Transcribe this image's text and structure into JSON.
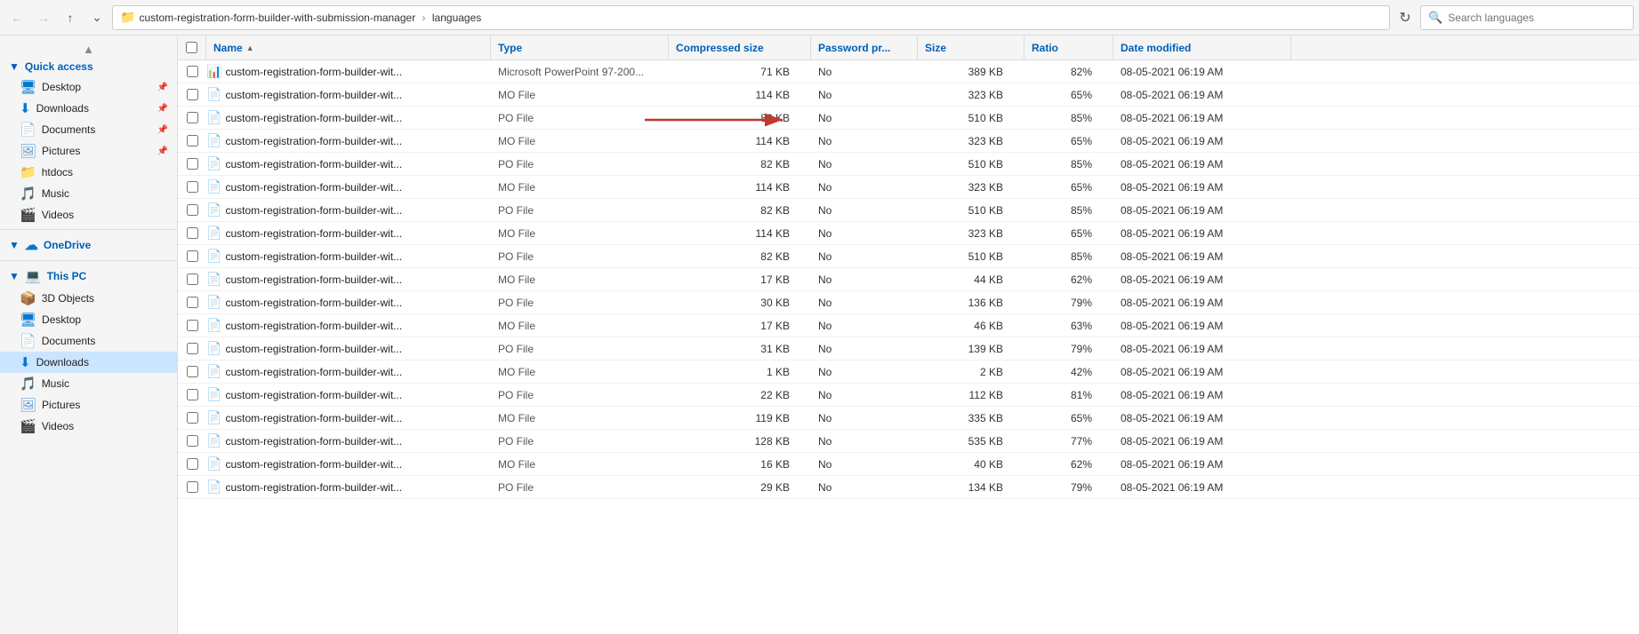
{
  "toolbar": {
    "back_disabled": true,
    "forward_disabled": true,
    "up_label": "Up",
    "address": {
      "icon": "📁",
      "path_part1": "custom-registration-form-builder-with-submission-manager",
      "separator": "›",
      "path_part2": "languages"
    },
    "search_placeholder": "Search languages"
  },
  "sidebar": {
    "quick_access_label": "Quick access",
    "items_quick": [
      {
        "id": "desktop",
        "label": "Desktop",
        "icon": "desktop",
        "pinned": true
      },
      {
        "id": "downloads",
        "label": "Downloads",
        "icon": "downloads",
        "pinned": true,
        "active": true
      },
      {
        "id": "documents",
        "label": "Documents",
        "icon": "docs",
        "pinned": true
      },
      {
        "id": "pictures",
        "label": "Pictures",
        "icon": "pics",
        "pinned": true
      },
      {
        "id": "htdocs",
        "label": "htdocs",
        "icon": "htdocs",
        "pinned": false
      },
      {
        "id": "music",
        "label": "Music",
        "icon": "music",
        "pinned": false
      },
      {
        "id": "videos",
        "label": "Videos",
        "icon": "videos",
        "pinned": false
      }
    ],
    "onedrive_label": "OneDrive",
    "thispc_label": "This PC",
    "items_pc": [
      {
        "id": "3dobjects",
        "label": "3D Objects",
        "icon": "3dobjects"
      },
      {
        "id": "desktop2",
        "label": "Desktop",
        "icon": "desktop"
      },
      {
        "id": "documents2",
        "label": "Documents",
        "icon": "docs"
      },
      {
        "id": "downloads2",
        "label": "Downloads",
        "icon": "downloads",
        "active": true
      },
      {
        "id": "music2",
        "label": "Music",
        "icon": "music"
      },
      {
        "id": "pictures2",
        "label": "Pictures",
        "icon": "pics"
      },
      {
        "id": "videos2",
        "label": "Videos",
        "icon": "videos"
      }
    ]
  },
  "columns": {
    "name": "Name",
    "type": "Type",
    "compressed_size": "Compressed size",
    "password_pr": "Password pr...",
    "size": "Size",
    "ratio": "Ratio",
    "date_modified": "Date modified"
  },
  "files": [
    {
      "name": "custom-registration-form-builder-wit...",
      "type": "Microsoft PowerPoint 97-200...",
      "compressed": "71 KB",
      "password": "No",
      "size": "389 KB",
      "ratio": "82%",
      "date": "08-05-2021 06:19 AM",
      "icon": "ppt"
    },
    {
      "name": "custom-registration-form-builder-wit...",
      "type": "MO File",
      "compressed": "114 KB",
      "password": "No",
      "size": "323 KB",
      "ratio": "65%",
      "date": "08-05-2021 06:19 AM",
      "icon": "file"
    },
    {
      "name": "custom-registration-form-builder-wit...",
      "type": "PO File",
      "compressed": "82 KB",
      "password": "No",
      "size": "510 KB",
      "ratio": "85%",
      "date": "08-05-2021 06:19 AM",
      "icon": "file",
      "arrow": true
    },
    {
      "name": "custom-registration-form-builder-wit...",
      "type": "MO File",
      "compressed": "114 KB",
      "password": "No",
      "size": "323 KB",
      "ratio": "65%",
      "date": "08-05-2021 06:19 AM",
      "icon": "file"
    },
    {
      "name": "custom-registration-form-builder-wit...",
      "type": "PO File",
      "compressed": "82 KB",
      "password": "No",
      "size": "510 KB",
      "ratio": "85%",
      "date": "08-05-2021 06:19 AM",
      "icon": "file"
    },
    {
      "name": "custom-registration-form-builder-wit...",
      "type": "MO File",
      "compressed": "114 KB",
      "password": "No",
      "size": "323 KB",
      "ratio": "65%",
      "date": "08-05-2021 06:19 AM",
      "icon": "file"
    },
    {
      "name": "custom-registration-form-builder-wit...",
      "type": "PO File",
      "compressed": "82 KB",
      "password": "No",
      "size": "510 KB",
      "ratio": "85%",
      "date": "08-05-2021 06:19 AM",
      "icon": "file"
    },
    {
      "name": "custom-registration-form-builder-wit...",
      "type": "MO File",
      "compressed": "114 KB",
      "password": "No",
      "size": "323 KB",
      "ratio": "65%",
      "date": "08-05-2021 06:19 AM",
      "icon": "file"
    },
    {
      "name": "custom-registration-form-builder-wit...",
      "type": "PO File",
      "compressed": "82 KB",
      "password": "No",
      "size": "510 KB",
      "ratio": "85%",
      "date": "08-05-2021 06:19 AM",
      "icon": "file"
    },
    {
      "name": "custom-registration-form-builder-wit...",
      "type": "MO File",
      "compressed": "17 KB",
      "password": "No",
      "size": "44 KB",
      "ratio": "62%",
      "date": "08-05-2021 06:19 AM",
      "icon": "file"
    },
    {
      "name": "custom-registration-form-builder-wit...",
      "type": "PO File",
      "compressed": "30 KB",
      "password": "No",
      "size": "136 KB",
      "ratio": "79%",
      "date": "08-05-2021 06:19 AM",
      "icon": "file"
    },
    {
      "name": "custom-registration-form-builder-wit...",
      "type": "MO File",
      "compressed": "17 KB",
      "password": "No",
      "size": "46 KB",
      "ratio": "63%",
      "date": "08-05-2021 06:19 AM",
      "icon": "file"
    },
    {
      "name": "custom-registration-form-builder-wit...",
      "type": "PO File",
      "compressed": "31 KB",
      "password": "No",
      "size": "139 KB",
      "ratio": "79%",
      "date": "08-05-2021 06:19 AM",
      "icon": "file"
    },
    {
      "name": "custom-registration-form-builder-wit...",
      "type": "MO File",
      "compressed": "1 KB",
      "password": "No",
      "size": "2 KB",
      "ratio": "42%",
      "date": "08-05-2021 06:19 AM",
      "icon": "file"
    },
    {
      "name": "custom-registration-form-builder-wit...",
      "type": "PO File",
      "compressed": "22 KB",
      "password": "No",
      "size": "112 KB",
      "ratio": "81%",
      "date": "08-05-2021 06:19 AM",
      "icon": "file"
    },
    {
      "name": "custom-registration-form-builder-wit...",
      "type": "MO File",
      "compressed": "119 KB",
      "password": "No",
      "size": "335 KB",
      "ratio": "65%",
      "date": "08-05-2021 06:19 AM",
      "icon": "file"
    },
    {
      "name": "custom-registration-form-builder-wit...",
      "type": "PO File",
      "compressed": "128 KB",
      "password": "No",
      "size": "535 KB",
      "ratio": "77%",
      "date": "08-05-2021 06:19 AM",
      "icon": "file"
    },
    {
      "name": "custom-registration-form-builder-wit...",
      "type": "MO File",
      "compressed": "16 KB",
      "password": "No",
      "size": "40 KB",
      "ratio": "62%",
      "date": "08-05-2021 06:19 AM",
      "icon": "file"
    },
    {
      "name": "custom-registration-form-builder-wit...",
      "type": "PO File",
      "compressed": "29 KB",
      "password": "No",
      "size": "134 KB",
      "ratio": "79%",
      "date": "08-05-2021 06:19 AM",
      "icon": "file"
    }
  ]
}
